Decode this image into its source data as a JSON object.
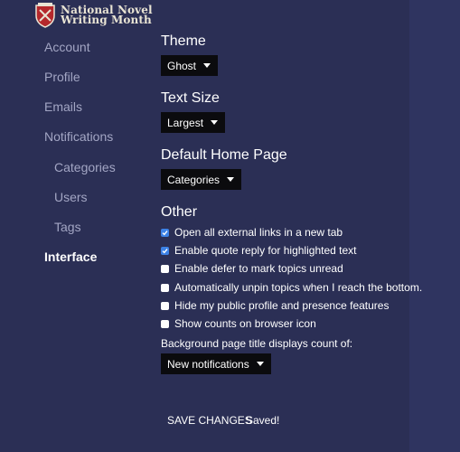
{
  "brand": {
    "line1": "National Novel",
    "line2": "Writing Month"
  },
  "nav": {
    "account": "Account",
    "profile": "Profile",
    "emails": "Emails",
    "notifications": "Notifications",
    "categories": "Categories",
    "users": "Users",
    "tags": "Tags",
    "interface": "Interface"
  },
  "theme": {
    "title": "Theme",
    "value": "Ghost"
  },
  "text_size": {
    "title": "Text Size",
    "value": "Largest"
  },
  "home_page": {
    "title": "Default Home Page",
    "value": "Categories"
  },
  "other": {
    "title": "Other",
    "options": [
      {
        "label": "Open all external links in a new tab",
        "checked": true
      },
      {
        "label": "Enable quote reply for highlighted text",
        "checked": true
      },
      {
        "label": "Enable defer to mark topics unread",
        "checked": false
      },
      {
        "label": "Automatically unpin topics when I reach the bottom.",
        "checked": false
      },
      {
        "label": "Hide my public profile and presence features",
        "checked": false
      },
      {
        "label": "Show counts on browser icon",
        "checked": false
      }
    ],
    "bg_title_label": "Background page title displays count of:",
    "bg_title_value": "New notifications"
  },
  "actions": {
    "save_label": "SAVE CHANGES",
    "saved_status": "Saved!"
  },
  "colors": {
    "background": "#2b2f55",
    "checkbox_checked": "#3d82e6",
    "select_bg": "#0b0b0e"
  }
}
